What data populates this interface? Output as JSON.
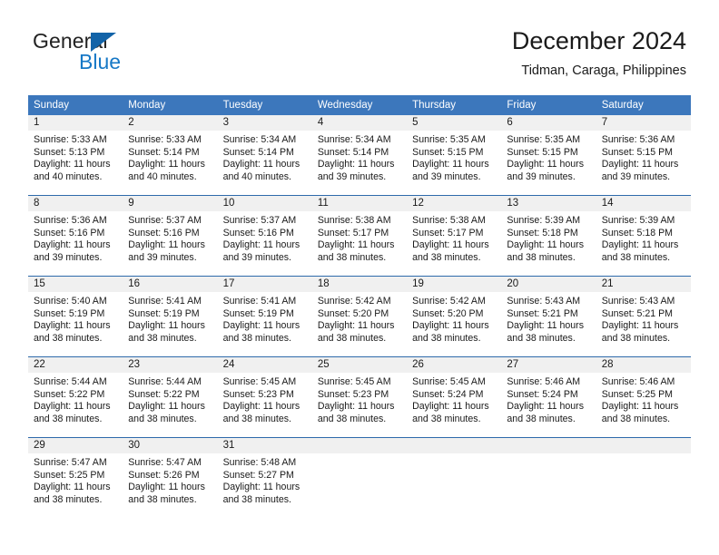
{
  "logo": {
    "word_one": "General",
    "word_two": "Blue",
    "triangle_icon": "blue-triangle-icon",
    "blue_hex": "#1678c6",
    "triangle_hex": "#1263a8"
  },
  "header": {
    "title": "December 2024",
    "subtitle": "Tidman, Caraga, Philippines"
  },
  "theme": {
    "header_bg": "#3c77bc",
    "row_divider": "#2e6aab",
    "daynum_bg": "#f0f0f0",
    "text": "#1a1a1a"
  },
  "weekdays": [
    "Sunday",
    "Monday",
    "Tuesday",
    "Wednesday",
    "Thursday",
    "Friday",
    "Saturday"
  ],
  "labels": {
    "sunrise_prefix": "Sunrise: ",
    "sunset_prefix": "Sunset: ",
    "daylight_prefix": "Daylight: "
  },
  "weeks": [
    [
      {
        "day": "1",
        "sunrise": "Sunrise: 5:33 AM",
        "sunset": "Sunset: 5:13 PM",
        "daylight_1": "Daylight: 11 hours",
        "daylight_2": "and 40 minutes."
      },
      {
        "day": "2",
        "sunrise": "Sunrise: 5:33 AM",
        "sunset": "Sunset: 5:14 PM",
        "daylight_1": "Daylight: 11 hours",
        "daylight_2": "and 40 minutes."
      },
      {
        "day": "3",
        "sunrise": "Sunrise: 5:34 AM",
        "sunset": "Sunset: 5:14 PM",
        "daylight_1": "Daylight: 11 hours",
        "daylight_2": "and 40 minutes."
      },
      {
        "day": "4",
        "sunrise": "Sunrise: 5:34 AM",
        "sunset": "Sunset: 5:14 PM",
        "daylight_1": "Daylight: 11 hours",
        "daylight_2": "and 39 minutes."
      },
      {
        "day": "5",
        "sunrise": "Sunrise: 5:35 AM",
        "sunset": "Sunset: 5:15 PM",
        "daylight_1": "Daylight: 11 hours",
        "daylight_2": "and 39 minutes."
      },
      {
        "day": "6",
        "sunrise": "Sunrise: 5:35 AM",
        "sunset": "Sunset: 5:15 PM",
        "daylight_1": "Daylight: 11 hours",
        "daylight_2": "and 39 minutes."
      },
      {
        "day": "7",
        "sunrise": "Sunrise: 5:36 AM",
        "sunset": "Sunset: 5:15 PM",
        "daylight_1": "Daylight: 11 hours",
        "daylight_2": "and 39 minutes."
      }
    ],
    [
      {
        "day": "8",
        "sunrise": "Sunrise: 5:36 AM",
        "sunset": "Sunset: 5:16 PM",
        "daylight_1": "Daylight: 11 hours",
        "daylight_2": "and 39 minutes."
      },
      {
        "day": "9",
        "sunrise": "Sunrise: 5:37 AM",
        "sunset": "Sunset: 5:16 PM",
        "daylight_1": "Daylight: 11 hours",
        "daylight_2": "and 39 minutes."
      },
      {
        "day": "10",
        "sunrise": "Sunrise: 5:37 AM",
        "sunset": "Sunset: 5:16 PM",
        "daylight_1": "Daylight: 11 hours",
        "daylight_2": "and 39 minutes."
      },
      {
        "day": "11",
        "sunrise": "Sunrise: 5:38 AM",
        "sunset": "Sunset: 5:17 PM",
        "daylight_1": "Daylight: 11 hours",
        "daylight_2": "and 38 minutes."
      },
      {
        "day": "12",
        "sunrise": "Sunrise: 5:38 AM",
        "sunset": "Sunset: 5:17 PM",
        "daylight_1": "Daylight: 11 hours",
        "daylight_2": "and 38 minutes."
      },
      {
        "day": "13",
        "sunrise": "Sunrise: 5:39 AM",
        "sunset": "Sunset: 5:18 PM",
        "daylight_1": "Daylight: 11 hours",
        "daylight_2": "and 38 minutes."
      },
      {
        "day": "14",
        "sunrise": "Sunrise: 5:39 AM",
        "sunset": "Sunset: 5:18 PM",
        "daylight_1": "Daylight: 11 hours",
        "daylight_2": "and 38 minutes."
      }
    ],
    [
      {
        "day": "15",
        "sunrise": "Sunrise: 5:40 AM",
        "sunset": "Sunset: 5:19 PM",
        "daylight_1": "Daylight: 11 hours",
        "daylight_2": "and 38 minutes."
      },
      {
        "day": "16",
        "sunrise": "Sunrise: 5:41 AM",
        "sunset": "Sunset: 5:19 PM",
        "daylight_1": "Daylight: 11 hours",
        "daylight_2": "and 38 minutes."
      },
      {
        "day": "17",
        "sunrise": "Sunrise: 5:41 AM",
        "sunset": "Sunset: 5:19 PM",
        "daylight_1": "Daylight: 11 hours",
        "daylight_2": "and 38 minutes."
      },
      {
        "day": "18",
        "sunrise": "Sunrise: 5:42 AM",
        "sunset": "Sunset: 5:20 PM",
        "daylight_1": "Daylight: 11 hours",
        "daylight_2": "and 38 minutes."
      },
      {
        "day": "19",
        "sunrise": "Sunrise: 5:42 AM",
        "sunset": "Sunset: 5:20 PM",
        "daylight_1": "Daylight: 11 hours",
        "daylight_2": "and 38 minutes."
      },
      {
        "day": "20",
        "sunrise": "Sunrise: 5:43 AM",
        "sunset": "Sunset: 5:21 PM",
        "daylight_1": "Daylight: 11 hours",
        "daylight_2": "and 38 minutes."
      },
      {
        "day": "21",
        "sunrise": "Sunrise: 5:43 AM",
        "sunset": "Sunset: 5:21 PM",
        "daylight_1": "Daylight: 11 hours",
        "daylight_2": "and 38 minutes."
      }
    ],
    [
      {
        "day": "22",
        "sunrise": "Sunrise: 5:44 AM",
        "sunset": "Sunset: 5:22 PM",
        "daylight_1": "Daylight: 11 hours",
        "daylight_2": "and 38 minutes."
      },
      {
        "day": "23",
        "sunrise": "Sunrise: 5:44 AM",
        "sunset": "Sunset: 5:22 PM",
        "daylight_1": "Daylight: 11 hours",
        "daylight_2": "and 38 minutes."
      },
      {
        "day": "24",
        "sunrise": "Sunrise: 5:45 AM",
        "sunset": "Sunset: 5:23 PM",
        "daylight_1": "Daylight: 11 hours",
        "daylight_2": "and 38 minutes."
      },
      {
        "day": "25",
        "sunrise": "Sunrise: 5:45 AM",
        "sunset": "Sunset: 5:23 PM",
        "daylight_1": "Daylight: 11 hours",
        "daylight_2": "and 38 minutes."
      },
      {
        "day": "26",
        "sunrise": "Sunrise: 5:45 AM",
        "sunset": "Sunset: 5:24 PM",
        "daylight_1": "Daylight: 11 hours",
        "daylight_2": "and 38 minutes."
      },
      {
        "day": "27",
        "sunrise": "Sunrise: 5:46 AM",
        "sunset": "Sunset: 5:24 PM",
        "daylight_1": "Daylight: 11 hours",
        "daylight_2": "and 38 minutes."
      },
      {
        "day": "28",
        "sunrise": "Sunrise: 5:46 AM",
        "sunset": "Sunset: 5:25 PM",
        "daylight_1": "Daylight: 11 hours",
        "daylight_2": "and 38 minutes."
      }
    ],
    [
      {
        "day": "29",
        "sunrise": "Sunrise: 5:47 AM",
        "sunset": "Sunset: 5:25 PM",
        "daylight_1": "Daylight: 11 hours",
        "daylight_2": "and 38 minutes."
      },
      {
        "day": "30",
        "sunrise": "Sunrise: 5:47 AM",
        "sunset": "Sunset: 5:26 PM",
        "daylight_1": "Daylight: 11 hours",
        "daylight_2": "and 38 minutes."
      },
      {
        "day": "31",
        "sunrise": "Sunrise: 5:48 AM",
        "sunset": "Sunset: 5:27 PM",
        "daylight_1": "Daylight: 11 hours",
        "daylight_2": "and 38 minutes."
      },
      {
        "day": "",
        "sunrise": "",
        "sunset": "",
        "daylight_1": "",
        "daylight_2": ""
      },
      {
        "day": "",
        "sunrise": "",
        "sunset": "",
        "daylight_1": "",
        "daylight_2": ""
      },
      {
        "day": "",
        "sunrise": "",
        "sunset": "",
        "daylight_1": "",
        "daylight_2": ""
      },
      {
        "day": "",
        "sunrise": "",
        "sunset": "",
        "daylight_1": "",
        "daylight_2": ""
      }
    ]
  ]
}
